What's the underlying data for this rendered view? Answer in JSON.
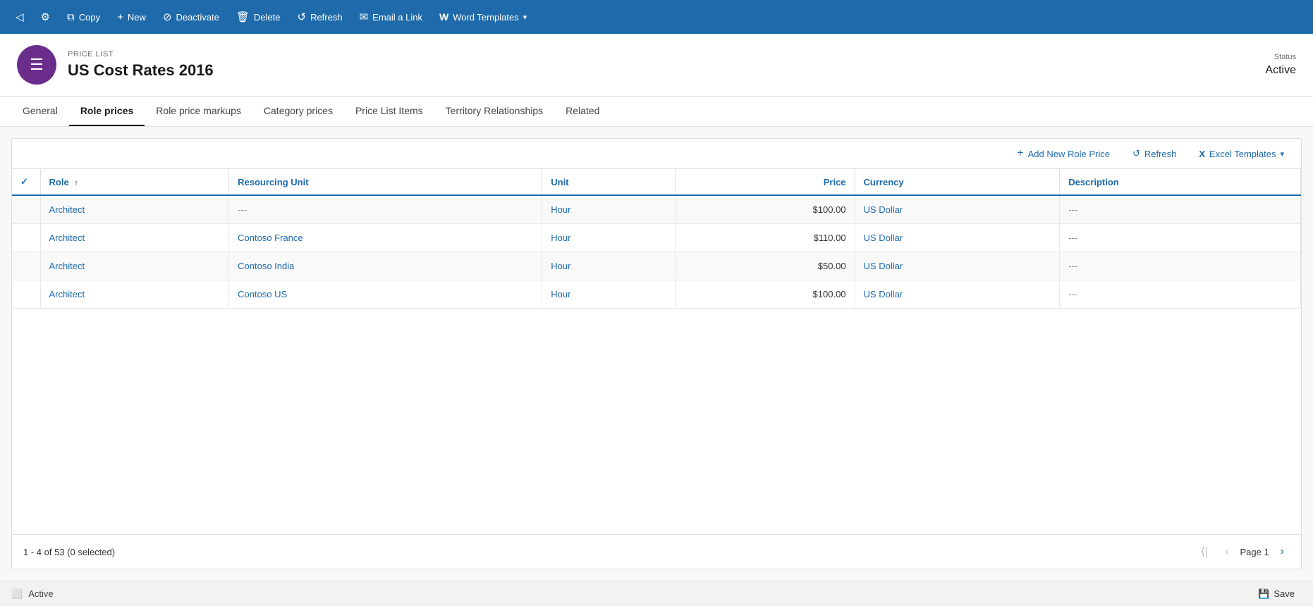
{
  "toolbar": {
    "buttons": [
      {
        "id": "copy",
        "label": "Copy",
        "icon": "⧉"
      },
      {
        "id": "new",
        "label": "New",
        "icon": "+"
      },
      {
        "id": "deactivate",
        "label": "Deactivate",
        "icon": "⊘"
      },
      {
        "id": "delete",
        "label": "Delete",
        "icon": "🗑"
      },
      {
        "id": "refresh",
        "label": "Refresh",
        "icon": "↺"
      },
      {
        "id": "email",
        "label": "Email a Link",
        "icon": "✉"
      },
      {
        "id": "word",
        "label": "Word Templates",
        "icon": "W"
      }
    ]
  },
  "record": {
    "type": "PRICE LIST",
    "title": "US Cost Rates 2016",
    "avatar_icon": "☰",
    "status_label": "Status",
    "status_value": "Active"
  },
  "tabs": [
    {
      "id": "general",
      "label": "General",
      "active": false
    },
    {
      "id": "role-prices",
      "label": "Role prices",
      "active": true
    },
    {
      "id": "role-price-markups",
      "label": "Role price markups",
      "active": false
    },
    {
      "id": "category-prices",
      "label": "Category prices",
      "active": false
    },
    {
      "id": "price-list-items",
      "label": "Price List Items",
      "active": false
    },
    {
      "id": "territory-relationships",
      "label": "Territory Relationships",
      "active": false
    },
    {
      "id": "related",
      "label": "Related",
      "active": false
    }
  ],
  "grid": {
    "add_btn_label": "Add New Role Price",
    "refresh_btn_label": "Refresh",
    "excel_btn_label": "Excel Templates",
    "columns": [
      {
        "id": "check",
        "label": ""
      },
      {
        "id": "role",
        "label": "Role",
        "sortable": true
      },
      {
        "id": "resourcing-unit",
        "label": "Resourcing Unit"
      },
      {
        "id": "unit",
        "label": "Unit"
      },
      {
        "id": "price",
        "label": "Price"
      },
      {
        "id": "currency",
        "label": "Currency"
      },
      {
        "id": "description",
        "label": "Description"
      }
    ],
    "rows": [
      {
        "role": "Architect",
        "resourcing_unit": "---",
        "unit": "Hour",
        "price": "$100.00",
        "currency": "US Dollar",
        "description": "---"
      },
      {
        "role": "Architect",
        "resourcing_unit": "Contoso France",
        "unit": "Hour",
        "price": "$110.00",
        "currency": "US Dollar",
        "description": "---"
      },
      {
        "role": "Architect",
        "resourcing_unit": "Contoso India",
        "unit": "Hour",
        "price": "$50.00",
        "currency": "US Dollar",
        "description": "---"
      },
      {
        "role": "Architect",
        "resourcing_unit": "Contoso US",
        "unit": "Hour",
        "price": "$100.00",
        "currency": "US Dollar",
        "description": "---"
      }
    ],
    "pagination": {
      "summary": "1 - 4 of 53 (0 selected)",
      "page_label": "Page 1"
    }
  },
  "statusbar": {
    "active_label": "Active",
    "save_label": "Save"
  }
}
